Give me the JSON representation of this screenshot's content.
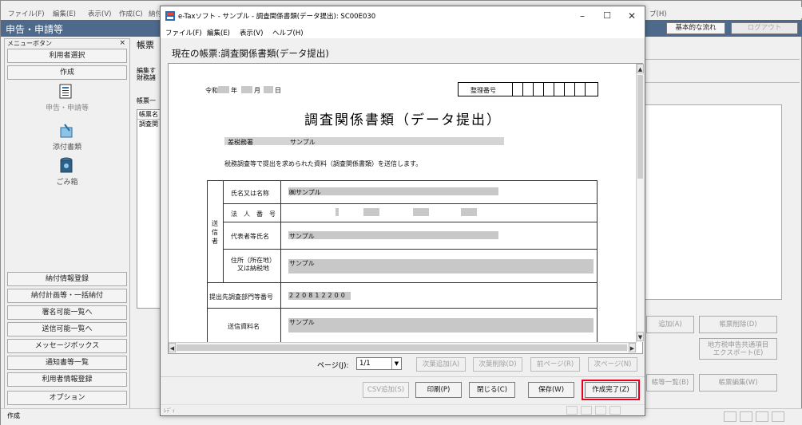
{
  "bg_app": {
    "menu": [
      "ファイル(F)",
      "編集(E)",
      "表示(V)",
      "作成(C)",
      "納付",
      "プ(H)"
    ],
    "header_title": "申告・申請等",
    "flow_button": "基本的な流れ",
    "logout_button": "ログアウト",
    "panel_label": "帳票",
    "panel_label_2": "帳票一",
    "edit_note": "編集す\n財務諸",
    "list_header": "帳票名",
    "list_item": "調査関",
    "status_text": "作成"
  },
  "sidebar": {
    "menu_button_label": "メニューボタン",
    "close": "×",
    "user_select": "利用者選択",
    "create": "作成",
    "icons": [
      {
        "label": "申告・申請等",
        "icon": "document-icon"
      },
      {
        "label": "添付書類",
        "icon": "attachment-icon"
      },
      {
        "label": "ごみ箱",
        "icon": "trash-icon"
      }
    ],
    "bottom_buttons": [
      "納付情報登録",
      "納付計画等・一括納付",
      "署名可能一覧へ",
      "送信可能一覧へ",
      "メッセージボックス",
      "通知書等一覧",
      "利用者情報登録",
      "オプション"
    ]
  },
  "right_panel": {
    "add_button": "追加(A)",
    "delete_button": "帳票削除(D)",
    "export_button_line1": "地方税申告共通項目",
    "export_button_line2": "エクスポート(E)",
    "list_button": "帳等一覧(B)",
    "edit_button": "帳票編集(W)"
  },
  "dialog": {
    "title": "e-Taxソフト - サンプル - 調査関係書類(データ提出): SC00E030",
    "menu": [
      "ファイル(F)",
      "編集(E)",
      "表示(V)",
      "ヘルプ(H)"
    ],
    "heading": "現在の帳票:調査関係書類(データ提出)",
    "doc": {
      "era": "令和",
      "year": "年",
      "month": "月",
      "day": "日",
      "ref_no_label": "整理番号",
      "title": "調査関係書類（データ提出）",
      "office_label": "差税務署",
      "office_value": "サンプル",
      "intro": "税務調査等で提出を求められた資料（調査関係書類）を送信します。",
      "sender_label": "送信者",
      "rows": [
        {
          "label": "氏名又は名称",
          "value": "㈱サンプル"
        },
        {
          "label": "法　人　番　号",
          "value": ""
        },
        {
          "label": "代表者等氏名",
          "value": "サンプル"
        },
        {
          "label": "住所（所在地）\n又は納税地",
          "value": "サンプル"
        }
      ],
      "dept_label": "提出先調査部門等番号",
      "dept_value": "220812200",
      "material_label": "送信資料名",
      "material_value": "サンプル"
    },
    "page_label": "ページ(J):",
    "page_value": "1/1",
    "nav_buttons": [
      "次葉追加(A)",
      "次葉削除(D)",
      "前ページ(R)",
      "次ページ(N)"
    ],
    "actions": {
      "csv": "CSV追加(S)",
      "print": "印刷(P)",
      "close": "閉じる(C)",
      "save": "保存(W)",
      "complete": "作成完了(Z)"
    },
    "status": "ﾚﾃﾞｨ",
    "highlight_color": "#e6001e"
  }
}
